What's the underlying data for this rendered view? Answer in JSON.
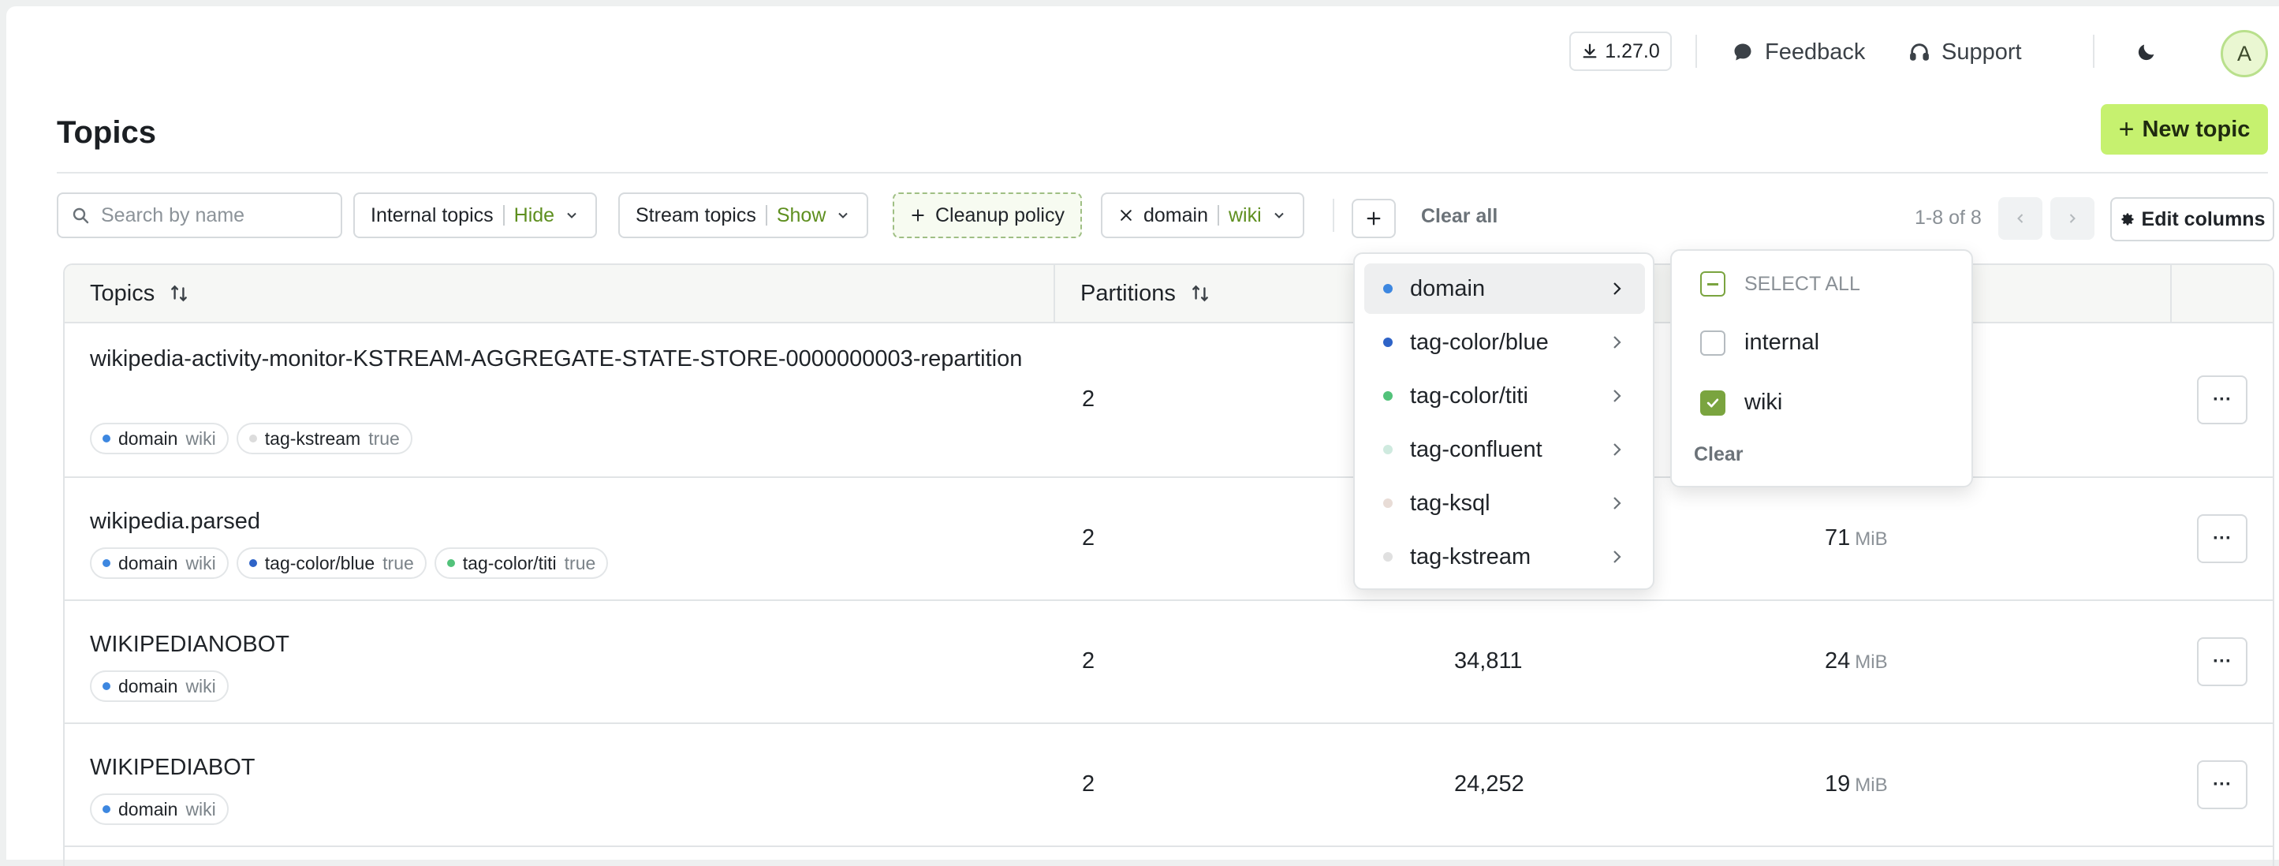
{
  "header": {
    "version": "1.27.0",
    "feedback": "Feedback",
    "support": "Support",
    "avatar_letter": "A"
  },
  "page": {
    "title": "Topics",
    "new_topic_label": "New topic"
  },
  "filters": {
    "search_placeholder": "Search by name",
    "internal_label": "Internal topics",
    "internal_value": "Hide",
    "stream_label": "Stream topics",
    "stream_value": "Show",
    "cleanup_label": "Cleanup policy",
    "domain_label": "domain",
    "domain_value": "wiki",
    "clear_all": "Clear all",
    "pager": "1-8 of 8",
    "edit_columns": "Edit columns"
  },
  "table": {
    "columns": [
      "Topics",
      "Partitions"
    ],
    "rows": [
      {
        "name": "wikipedia-activity-monitor-KSTREAM-AGGREGATE-STATE-STORE-0000000003-repartition",
        "tags": [
          {
            "key": "domain",
            "value": "wiki",
            "color": "#3d87e0"
          },
          {
            "key": "tag-kstream",
            "value": "true",
            "color": "#dcdcdc"
          }
        ],
        "partitions": "2",
        "count": "",
        "size": "",
        "size_unit": ""
      },
      {
        "name": "wikipedia.parsed",
        "tags": [
          {
            "key": "domain",
            "value": "wiki",
            "color": "#3d87e0"
          },
          {
            "key": "tag-color/blue",
            "value": "true",
            "color": "#2e63c7"
          },
          {
            "key": "tag-color/titi",
            "value": "true",
            "color": "#52c27a"
          }
        ],
        "partitions": "2",
        "count": "",
        "size": "71",
        "size_unit": "MiB"
      },
      {
        "name": "WIKIPEDIANOBOT",
        "tags": [
          {
            "key": "domain",
            "value": "wiki",
            "color": "#3d87e0"
          }
        ],
        "partitions": "2",
        "count": "34,811",
        "size": "24",
        "size_unit": "MiB"
      },
      {
        "name": "WIKIPEDIABOT",
        "tags": [
          {
            "key": "domain",
            "value": "wiki",
            "color": "#3d87e0"
          }
        ],
        "partitions": "2",
        "count": "24,252",
        "size": "19",
        "size_unit": "MiB"
      }
    ]
  },
  "tag_menu": {
    "items": [
      {
        "label": "domain",
        "color": "#3d87e0"
      },
      {
        "label": "tag-color/blue",
        "color": "#2e63c7"
      },
      {
        "label": "tag-color/titi",
        "color": "#52c27a"
      },
      {
        "label": "tag-confluent",
        "color": "#cfeadf"
      },
      {
        "label": "tag-ksql",
        "color": "#e8dcd6"
      },
      {
        "label": "tag-kstream",
        "color": "#e0e0e0"
      }
    ]
  },
  "value_menu": {
    "select_all": "SELECT ALL",
    "options": [
      {
        "label": "internal",
        "checked": false
      },
      {
        "label": "wiki",
        "checked": true
      }
    ],
    "clear": "Clear"
  },
  "colors": {
    "accent": "#c6f16f",
    "value_green": "#5e8f1f",
    "checkbox_green": "#7aa43f"
  }
}
